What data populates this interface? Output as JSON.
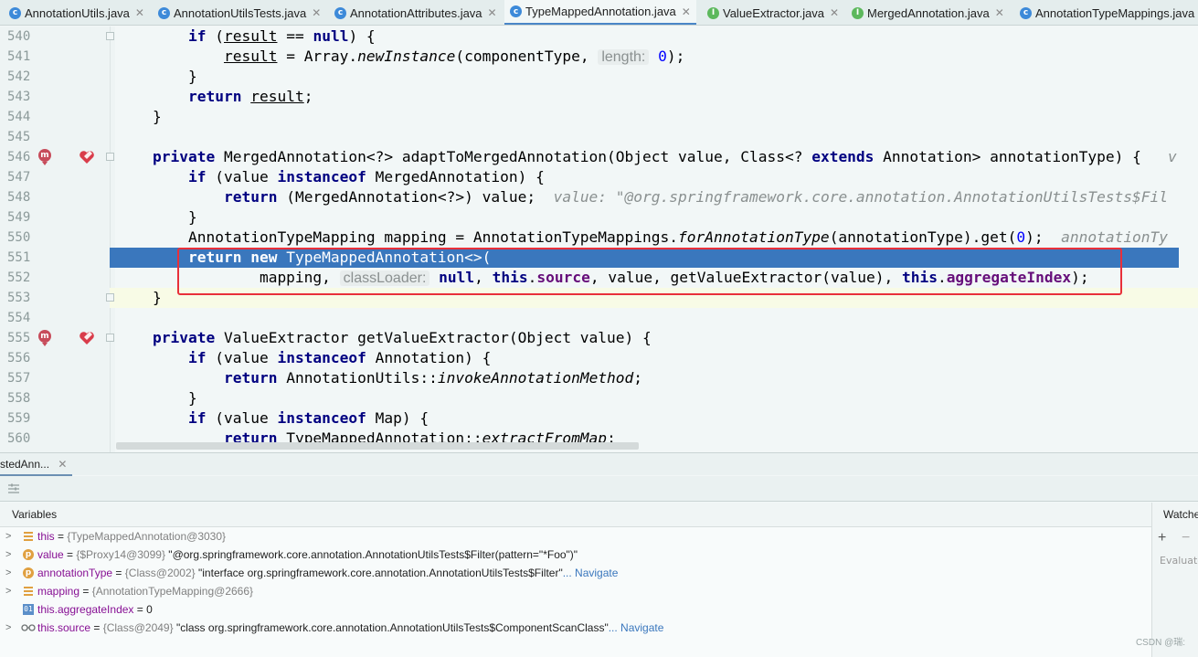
{
  "tabs": [
    {
      "label": "AnnotationUtils.java",
      "icon": "class-icon",
      "active": false
    },
    {
      "label": "AnnotationUtilsTests.java",
      "icon": "test-class-icon",
      "active": false
    },
    {
      "label": "AnnotationAttributes.java",
      "icon": "class-icon",
      "active": false
    },
    {
      "label": "TypeMappedAnnotation.java",
      "icon": "class-icon",
      "active": true
    },
    {
      "label": "ValueExtractor.java",
      "icon": "interface-icon",
      "active": false
    },
    {
      "label": "MergedAnnotation.java",
      "icon": "interface-icon",
      "active": false
    },
    {
      "label": "AnnotationTypeMappings.java",
      "icon": "class-icon",
      "active": false
    }
  ],
  "editor": {
    "line_numbers": [
      "540",
      "541",
      "542",
      "543",
      "544",
      "545",
      "546",
      "547",
      "548",
      "549",
      "550",
      "551",
      "552",
      "553",
      "554",
      "555",
      "556",
      "557",
      "558",
      "559",
      "560"
    ],
    "hint_length": "length:",
    "hint_classloader": "classLoader:",
    "inline_value_548": "value: \"@org.springframework.core.annotation.AnnotationUtilsTests$Fil",
    "inline_value_550": "annotationTy",
    "inline_value_546": "v"
  },
  "debug": {
    "tab_label": "stedAnn...",
    "variables_title": "Variables",
    "watches_title": "Watches",
    "watches_eval_placeholder": "Evaluate",
    "variables": [
      {
        "name": "this",
        "eq": " = ",
        "type": "{TypeMappedAnnotation@3030}",
        "value": "",
        "navigate": "",
        "icon": "field-icon",
        "expandable": true
      },
      {
        "name": "value",
        "eq": " = ",
        "type": "{$Proxy14@3099}",
        "value": " \"@org.springframework.core.annotation.AnnotationUtilsTests$Filter(pattern=\"*Foo\")\"",
        "navigate": "",
        "icon": "parameter-icon",
        "expandable": true
      },
      {
        "name": "annotationType",
        "eq": " = ",
        "type": "{Class@2002}",
        "value": " \"interface org.springframework.core.annotation.AnnotationUtilsTests$Filter\"",
        "navigate": "... Navigate",
        "icon": "parameter-icon",
        "expandable": true
      },
      {
        "name": "mapping",
        "eq": " = ",
        "type": "{AnnotationTypeMapping@2666}",
        "value": "",
        "navigate": "",
        "icon": "field-icon",
        "expandable": true
      },
      {
        "name": "this.aggregateIndex",
        "eq": " = ",
        "type": "",
        "value": "0",
        "navigate": "",
        "icon": "primitive-icon",
        "expandable": false
      },
      {
        "name": "this.source",
        "eq": " = ",
        "type": "{Class@2049}",
        "value": " \"class org.springframework.core.annotation.AnnotationUtilsTests$ComponentScanClass\"",
        "navigate": "... Navigate",
        "icon": "watch-icon",
        "expandable": true
      }
    ]
  },
  "watermark": "CSDN @瑞:"
}
